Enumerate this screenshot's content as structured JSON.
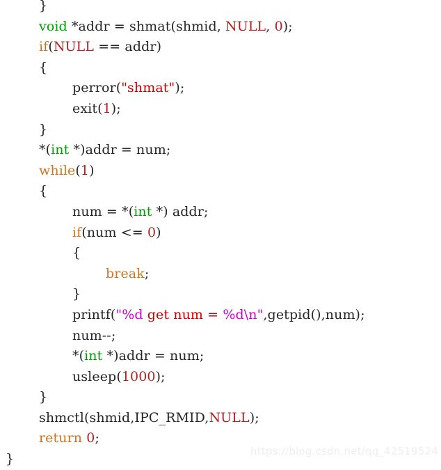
{
  "colors": {
    "background": "#ffffff",
    "plain_text": "#262626",
    "type_keyword": "#00a000",
    "control_keyword": "#c87820",
    "number": "#b22222",
    "string": "#cc0000",
    "format_specifier": "#cc00cc",
    "watermark": "#eeeeee"
  },
  "code": {
    "language": "c",
    "lines": [
      {
        "id": "line-0",
        "indent": 48,
        "tokens": [
          {
            "t": "}",
            "c": "tok-plain"
          }
        ]
      },
      {
        "id": "line-1",
        "indent": 48,
        "tokens": [
          {
            "t": "void",
            "c": "tok-type"
          },
          {
            "t": " *addr = shmat(shmid, ",
            "c": "tok-plain"
          },
          {
            "t": "NULL",
            "c": "tok-null"
          },
          {
            "t": ", ",
            "c": "tok-plain"
          },
          {
            "t": "0",
            "c": "tok-num"
          },
          {
            "t": ");",
            "c": "tok-plain"
          }
        ]
      },
      {
        "id": "line-2",
        "indent": 48,
        "tokens": [
          {
            "t": "if",
            "c": "tok-kw"
          },
          {
            "t": "(",
            "c": "tok-plain"
          },
          {
            "t": "NULL",
            "c": "tok-null"
          },
          {
            "t": " == addr)",
            "c": "tok-plain"
          }
        ]
      },
      {
        "id": "line-3",
        "indent": 48,
        "tokens": [
          {
            "t": "{",
            "c": "tok-plain"
          }
        ]
      },
      {
        "id": "line-4",
        "indent": 96,
        "tokens": [
          {
            "t": "perror(",
            "c": "tok-plain"
          },
          {
            "t": "\"shmat\"",
            "c": "tok-str"
          },
          {
            "t": ");",
            "c": "tok-plain"
          }
        ]
      },
      {
        "id": "line-5",
        "indent": 96,
        "tokens": [
          {
            "t": "exit(",
            "c": "tok-plain"
          },
          {
            "t": "1",
            "c": "tok-num"
          },
          {
            "t": ");",
            "c": "tok-plain"
          }
        ]
      },
      {
        "id": "line-6",
        "indent": 48,
        "tokens": [
          {
            "t": "}",
            "c": "tok-plain"
          }
        ]
      },
      {
        "id": "line-7",
        "indent": 48,
        "tokens": [
          {
            "t": "*(",
            "c": "tok-plain"
          },
          {
            "t": "int",
            "c": "tok-type"
          },
          {
            "t": " *)addr = num;",
            "c": "tok-plain"
          }
        ]
      },
      {
        "id": "line-8",
        "indent": 48,
        "tokens": [
          {
            "t": "while",
            "c": "tok-kw"
          },
          {
            "t": "(",
            "c": "tok-plain"
          },
          {
            "t": "1",
            "c": "tok-num"
          },
          {
            "t": ")",
            "c": "tok-plain"
          }
        ]
      },
      {
        "id": "line-9",
        "indent": 48,
        "tokens": [
          {
            "t": "{",
            "c": "tok-plain"
          }
        ]
      },
      {
        "id": "line-10",
        "indent": 96,
        "tokens": [
          {
            "t": "num = *(",
            "c": "tok-plain"
          },
          {
            "t": "int",
            "c": "tok-type"
          },
          {
            "t": " *) addr;",
            "c": "tok-plain"
          }
        ]
      },
      {
        "id": "line-11",
        "indent": 96,
        "tokens": [
          {
            "t": "if",
            "c": "tok-kw"
          },
          {
            "t": "(num <= ",
            "c": "tok-plain"
          },
          {
            "t": "0",
            "c": "tok-num"
          },
          {
            "t": ")",
            "c": "tok-plain"
          }
        ]
      },
      {
        "id": "line-12",
        "indent": 96,
        "tokens": [
          {
            "t": "{",
            "c": "tok-plain"
          }
        ]
      },
      {
        "id": "line-13",
        "indent": 144,
        "tokens": [
          {
            "t": "break",
            "c": "tok-kw"
          },
          {
            "t": ";",
            "c": "tok-plain"
          }
        ]
      },
      {
        "id": "line-14",
        "indent": 96,
        "tokens": [
          {
            "t": "}",
            "c": "tok-plain"
          }
        ]
      },
      {
        "id": "line-15",
        "indent": 96,
        "tokens": [
          {
            "t": "printf(",
            "c": "tok-plain"
          },
          {
            "t": "\"",
            "c": "tok-fmt"
          },
          {
            "t": "%d",
            "c": "tok-fmt"
          },
          {
            "t": " get num = ",
            "c": "tok-str"
          },
          {
            "t": "%d\\n\"",
            "c": "tok-fmt"
          },
          {
            "t": ",getpid(),num);",
            "c": "tok-plain"
          }
        ]
      },
      {
        "id": "line-16",
        "indent": 96,
        "tokens": [
          {
            "t": "num--;",
            "c": "tok-plain"
          }
        ]
      },
      {
        "id": "line-17",
        "indent": 96,
        "tokens": [
          {
            "t": "*(",
            "c": "tok-plain"
          },
          {
            "t": "int",
            "c": "tok-type"
          },
          {
            "t": " *)addr = num;",
            "c": "tok-plain"
          }
        ]
      },
      {
        "id": "line-18",
        "indent": 96,
        "tokens": [
          {
            "t": "usleep(",
            "c": "tok-plain"
          },
          {
            "t": "1000",
            "c": "tok-num"
          },
          {
            "t": ");",
            "c": "tok-plain"
          }
        ]
      },
      {
        "id": "line-19",
        "indent": 48,
        "tokens": [
          {
            "t": "}",
            "c": "tok-plain"
          }
        ]
      },
      {
        "id": "line-20",
        "indent": 48,
        "tokens": [
          {
            "t": "shmctl(shmid,IPC_RMID,",
            "c": "tok-plain"
          },
          {
            "t": "NULL",
            "c": "tok-null"
          },
          {
            "t": ");",
            "c": "tok-plain"
          }
        ]
      },
      {
        "id": "line-21",
        "indent": 48,
        "tokens": [
          {
            "t": "return",
            "c": "tok-kw"
          },
          {
            "t": " ",
            "c": "tok-plain"
          },
          {
            "t": "0",
            "c": "tok-num"
          },
          {
            "t": ";",
            "c": "tok-plain"
          }
        ]
      },
      {
        "id": "line-22",
        "indent": 0,
        "tokens": [
          {
            "t": "}",
            "c": "tok-plain"
          }
        ]
      }
    ]
  },
  "watermark": {
    "text": "https://blog.csdn.net/qq_42519524"
  }
}
